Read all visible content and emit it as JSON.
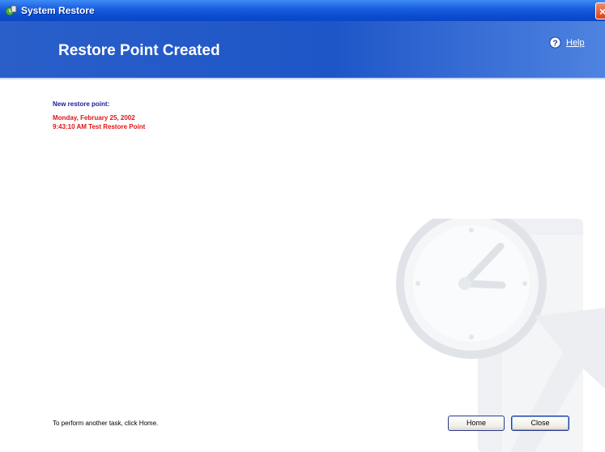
{
  "window": {
    "title": "System Restore",
    "close_glyph": "×"
  },
  "header": {
    "page_title": "Restore Point Created",
    "help_label": "Help"
  },
  "content": {
    "new_point_label": "New restore point:",
    "restore_point_date": "Monday, February 25, 2002",
    "restore_point_description": "9:43:10 AM  Test Restore Point"
  },
  "footer": {
    "hint": "To perform another task, click Home.",
    "home_button": "Home",
    "close_button": "Close"
  },
  "icons": {
    "app": "system-restore-icon",
    "help": "help-icon",
    "watermark": "clock-restore-watermark-icon"
  },
  "colors": {
    "header_blue": "#1e56c8",
    "label_blue": "#1b1b9c",
    "restore_point_red": "#e01414"
  }
}
